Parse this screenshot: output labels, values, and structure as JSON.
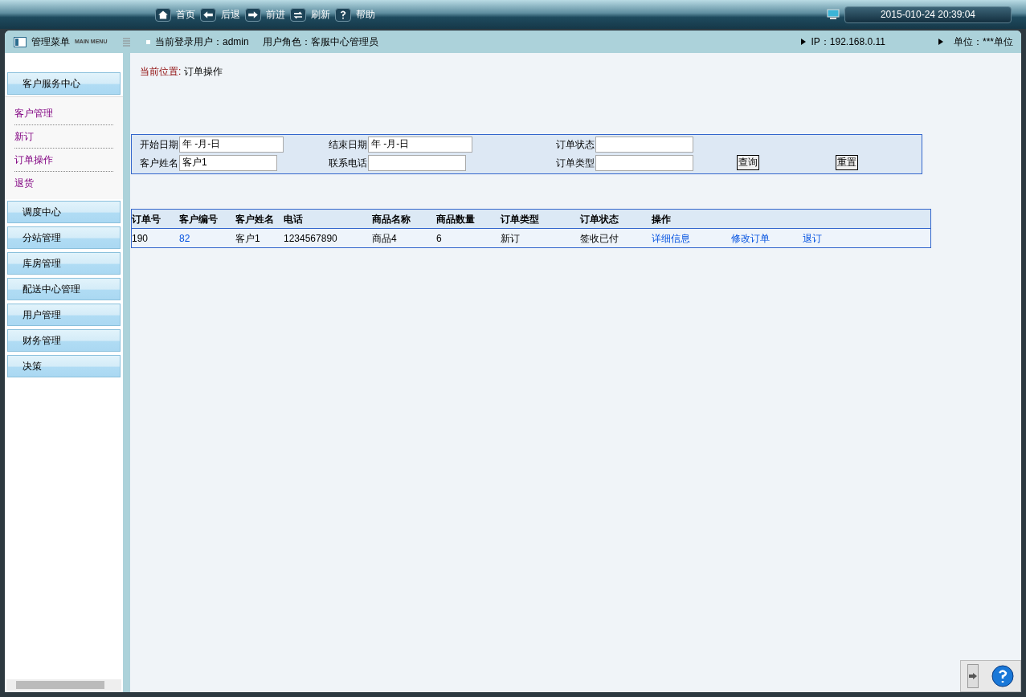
{
  "toolbar": {
    "items": [
      {
        "kind": "home",
        "label": "首页"
      },
      {
        "kind": "back",
        "label": "后退"
      },
      {
        "kind": "forward",
        "label": "前进"
      },
      {
        "kind": "refresh",
        "label": "刷新"
      },
      {
        "kind": "help",
        "label": "帮助"
      }
    ],
    "datetime": "2015-010-24 20:39:04"
  },
  "header": {
    "menu_title": "管理菜单",
    "menu_subtitle": "MAIN MENU",
    "user": "当前登录用户：admin",
    "role": "用户角色：客服中心管理员",
    "ip": "IP：192.168.0.11",
    "unit": "单位：***单位"
  },
  "sidebar": {
    "sections": [
      {
        "label": "客户服务中心",
        "children": [
          {
            "label": "客户管理"
          },
          {
            "label": "新订"
          },
          {
            "label": "订单操作"
          },
          {
            "label": "退货"
          }
        ]
      },
      {
        "label": "调度中心"
      },
      {
        "label": "分站管理"
      },
      {
        "label": "库房管理"
      },
      {
        "label": "配送中心管理"
      },
      {
        "label": "用户管理"
      },
      {
        "label": "财务管理"
      },
      {
        "label": "决策"
      }
    ]
  },
  "breadcrumb": {
    "label": "当前位置:",
    "value": "订单操作"
  },
  "filter": {
    "fields": [
      {
        "label": "开始日期",
        "value": "年 -月-日"
      },
      {
        "label": "结束日期",
        "value": "年 -月-日"
      },
      {
        "label": "订单状态"
      },
      {
        "label": "客户姓名",
        "value": "客户1"
      },
      {
        "label": "联系电话"
      },
      {
        "label": "订单类型"
      }
    ],
    "buttons": [
      "查询",
      "重置"
    ]
  },
  "table": {
    "columns": [
      "订单号",
      "客户编号",
      "客户姓名",
      "电话",
      "商品名称",
      "商品数量",
      "订单类型",
      "订单状态",
      "操作"
    ],
    "rows": [
      {
        "cells": [
          {
            "text": "190",
            "kind": "text"
          },
          {
            "text": "82",
            "kind": "link"
          },
          {
            "text": "客户1",
            "kind": "text"
          },
          {
            "text": "1234567890",
            "kind": "text"
          },
          {
            "text": "商品4",
            "kind": "text"
          },
          {
            "text": "6",
            "kind": "text"
          },
          {
            "text": "新订",
            "kind": "text"
          },
          {
            "text": "签收已付",
            "kind": "text"
          },
          {
            "text": "详细信息",
            "kind": "link"
          },
          {
            "text": "修改订单",
            "kind": "link"
          },
          {
            "text": "退订",
            "kind": "link"
          }
        ]
      }
    ]
  }
}
